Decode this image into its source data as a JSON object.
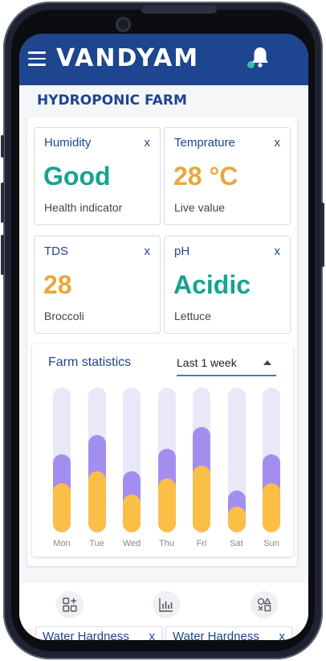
{
  "app": {
    "brand": "VANDYAM"
  },
  "page": {
    "title": "HYDROPONIC FARM"
  },
  "cards": [
    {
      "label": "Humidity",
      "close": "x",
      "value": "Good",
      "sub": "Health indicator"
    },
    {
      "label": "Temprature",
      "close": "x",
      "value": "28 °C",
      "sub": "Live value"
    },
    {
      "label": "TDS",
      "close": "x",
      "value": "28",
      "sub": "Broccoli"
    },
    {
      "label": "pH",
      "close": "x",
      "value": "Acidic",
      "sub": "Lettuce"
    }
  ],
  "stats": {
    "title": "Farm statistics",
    "range_selected": "Last 1 week"
  },
  "chart_data": {
    "type": "bar",
    "categories": [
      "Mon",
      "Tue",
      "Wed",
      "Thu",
      "Fri",
      "Sat",
      "Sun"
    ],
    "series": [
      {
        "values": [
          0.54,
          0.67,
          0.42,
          0.58,
          0.73,
          0.29,
          0.54
        ]
      },
      {
        "values": [
          0.34,
          0.42,
          0.26,
          0.37,
          0.46,
          0.18,
          0.34
        ]
      }
    ],
    "ylim": [
      0,
      1
    ],
    "colors": [
      "#a38ef0",
      "#fbbf48"
    ],
    "track_color": "#e8e8f8"
  },
  "peek_cards": [
    {
      "label": "Water Hardness",
      "close": "x"
    },
    {
      "label": "Water Hardness",
      "close": "x"
    }
  ],
  "nav": {
    "icons": [
      "add-widget-icon",
      "bar-chart-icon",
      "shapes-icon"
    ]
  },
  "colors": {
    "primary": "#1d4590",
    "accent_green": "#17a391",
    "accent_orange": "#e9a83c",
    "notification": "#2ec4a0"
  }
}
